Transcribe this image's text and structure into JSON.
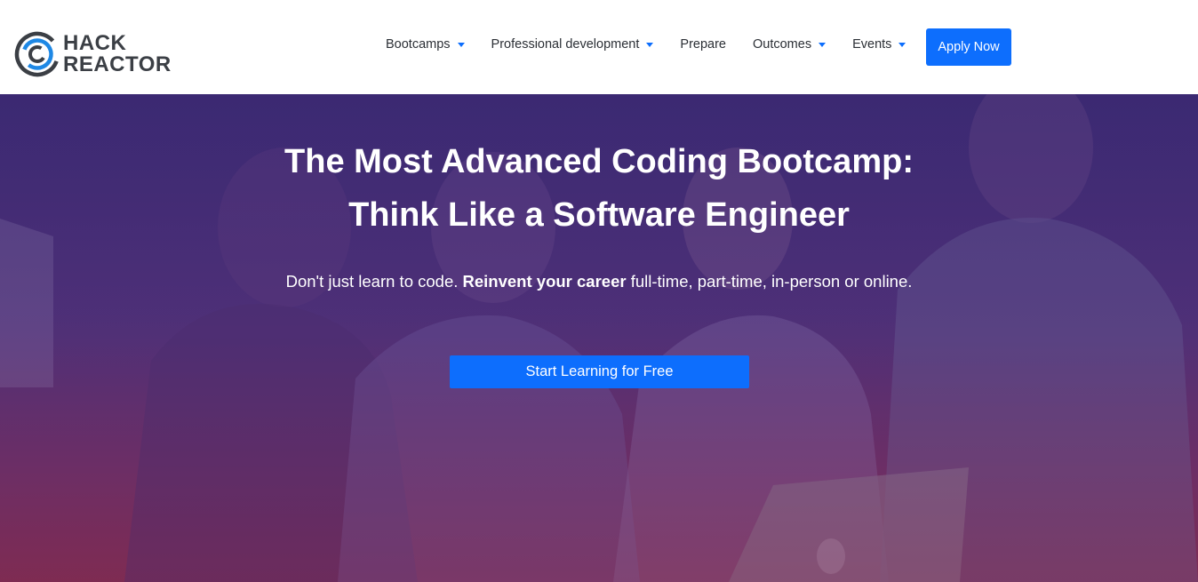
{
  "brand": {
    "line1": "HACK",
    "line2": "REACTOR"
  },
  "nav": {
    "items": [
      {
        "label": "Bootcamps",
        "has_dropdown": true
      },
      {
        "label": "Professional development",
        "has_dropdown": true
      },
      {
        "label": "Prepare",
        "has_dropdown": false
      },
      {
        "label": "Outcomes",
        "has_dropdown": true
      },
      {
        "label": "Events",
        "has_dropdown": true
      }
    ],
    "apply_label": "Apply Now"
  },
  "hero": {
    "title_line1": "The Most Advanced Coding Bootcamp:",
    "title_line2": "Think Like a Software Engineer",
    "subtitle_pre": "Don't just learn to code. ",
    "subtitle_bold": "Reinvent your career",
    "subtitle_post": " full-time, part-time, in-person or online.",
    "cta_label": "Start Learning for Free"
  },
  "colors": {
    "accent": "#0d6efd",
    "logo_text": "#3b3f45",
    "nav_text": "#2b2f35",
    "logo_ring_blue": "#1e88e5"
  }
}
